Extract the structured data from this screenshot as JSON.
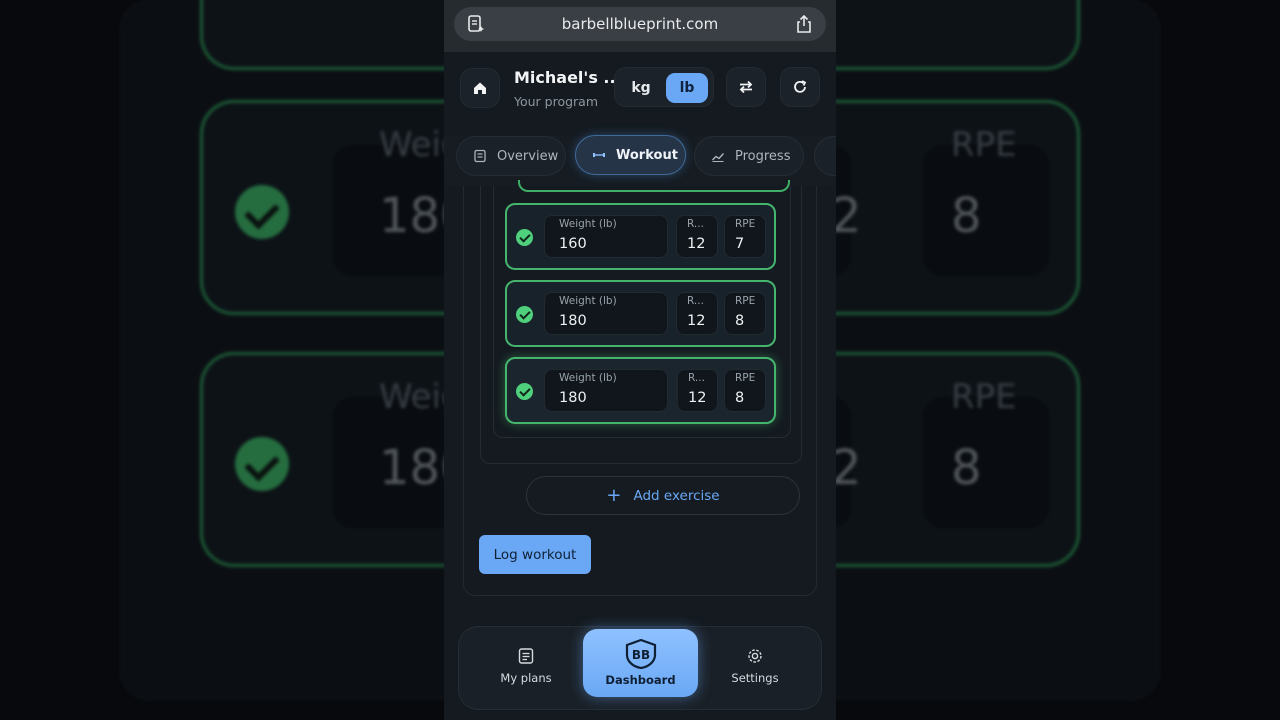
{
  "browser": {
    "url": "barbellblueprint.com"
  },
  "header": {
    "title": "Michael's ...",
    "subtitle": "Your program",
    "units": [
      "kg",
      "lb"
    ],
    "active_unit": "lb"
  },
  "tabs": [
    {
      "label": "Overview",
      "active": false
    },
    {
      "label": "Workout",
      "active": true
    },
    {
      "label": "Progress",
      "active": false
    }
  ],
  "sets": [
    {
      "weight_label": "Weight (lb)",
      "weight": "160",
      "reps_label": "R...",
      "reps": "12",
      "rpe_label": "RPE",
      "rpe": "7",
      "completed": true
    },
    {
      "weight_label": "Weight (lb)",
      "weight": "180",
      "reps_label": "R...",
      "reps": "12",
      "rpe_label": "RPE",
      "rpe": "8",
      "completed": true
    },
    {
      "weight_label": "Weight (lb)",
      "weight": "180",
      "reps_label": "R...",
      "reps": "12",
      "rpe_label": "RPE",
      "rpe": "8",
      "completed": true
    }
  ],
  "actions": {
    "add_exercise": "Add exercise",
    "log_workout": "Log workout"
  },
  "bottom_nav": [
    {
      "label": "My plans",
      "active": false
    },
    {
      "label": "Dashboard",
      "active": true
    },
    {
      "label": "Settings",
      "active": false
    }
  ],
  "backdrop": {
    "weight_label": "Weig",
    "weight": "180",
    "rpe_label": "RPE",
    "rpe": "8",
    "reps_fragment": "2"
  },
  "colors": {
    "accent": "#6aa8f5",
    "success": "#45b56d",
    "background": "#141a20"
  }
}
